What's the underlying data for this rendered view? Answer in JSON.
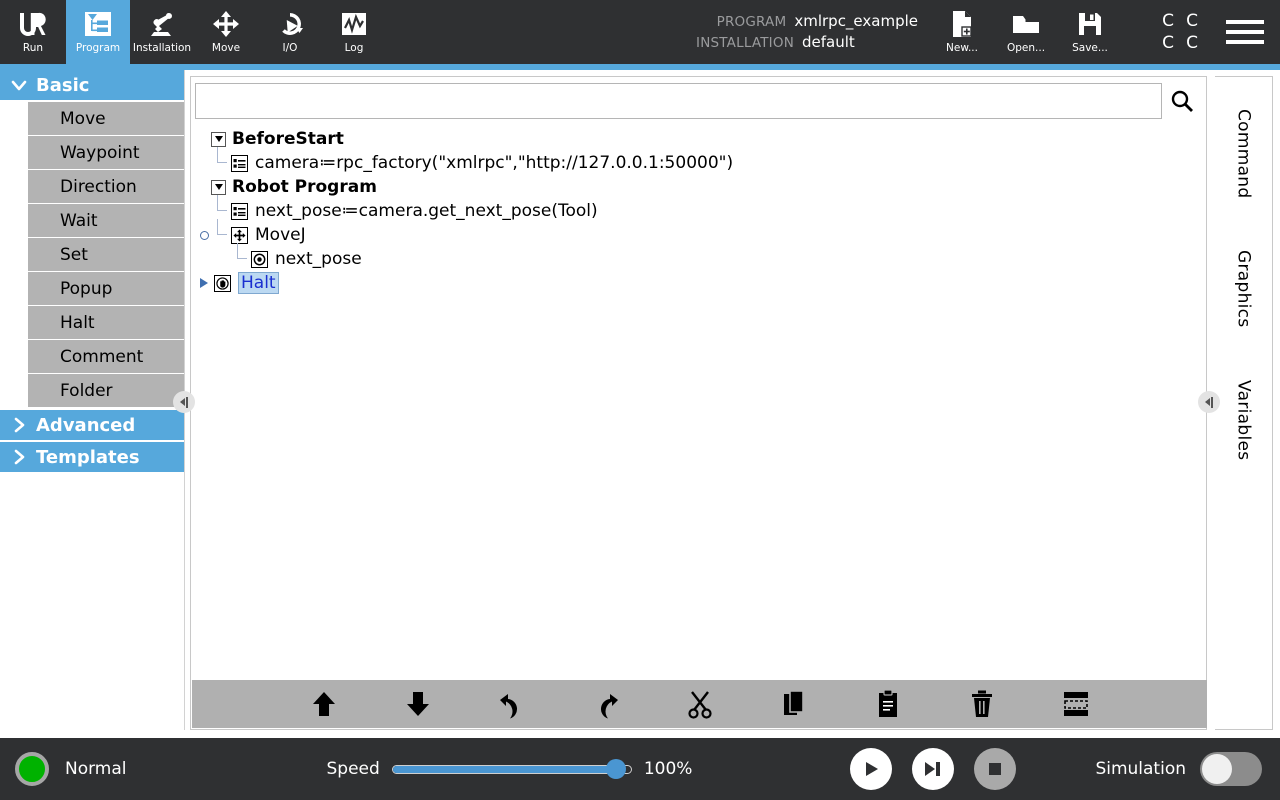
{
  "header": {
    "tabs": [
      {
        "label": "Run",
        "icon": "ur-logo-icon",
        "active": false
      },
      {
        "label": "Program",
        "icon": "program-tree-icon",
        "active": true
      },
      {
        "label": "Installation",
        "icon": "robot-arm-icon",
        "active": false
      },
      {
        "label": "Move",
        "icon": "move-arrows-icon",
        "active": false
      },
      {
        "label": "I/O",
        "icon": "io-gauge-icon",
        "active": false
      },
      {
        "label": "Log",
        "icon": "log-graph-icon",
        "active": false
      }
    ],
    "program_key": "PROGRAM",
    "program_value": "xmlrpc_example",
    "installation_key": "INSTALLATION",
    "installation_value": "default",
    "actions": [
      {
        "label": "New...",
        "icon": "new-file-icon"
      },
      {
        "label": "Open...",
        "icon": "open-folder-icon"
      },
      {
        "label": "Save...",
        "icon": "save-floppy-icon"
      }
    ],
    "cc_grid": [
      "C",
      "C",
      "C",
      "C"
    ],
    "menu_icon": "hamburger-menu-icon",
    "accent_color": "#56a8dc",
    "bar_color": "#2f3032"
  },
  "sidebar": {
    "groups": [
      {
        "label": "Basic",
        "expanded": true,
        "items": [
          "Move",
          "Waypoint",
          "Direction",
          "Wait",
          "Set",
          "Popup",
          "Halt",
          "Comment",
          "Folder"
        ]
      },
      {
        "label": "Advanced",
        "expanded": false,
        "items": []
      },
      {
        "label": "Templates",
        "expanded": false,
        "items": []
      }
    ],
    "collapse_handle_icon": "collapse-left-handle-icon"
  },
  "main": {
    "search": {
      "value": "",
      "placeholder": "",
      "button_icon": "search-icon"
    },
    "tree": [
      {
        "id": "before-start",
        "type": "node",
        "label": "BeforeStart",
        "depth": 0,
        "toggle_icon": "triangle-down-icon",
        "expanded": true
      },
      {
        "id": "camera-assign",
        "type": "leaf",
        "label": "camera≔rpc_factory(\"xmlrpc\",\"http://127.0.0.1:50000\")",
        "depth": 1,
        "icon": "script-assignment-icon",
        "selected": false
      },
      {
        "id": "robot-program",
        "type": "node",
        "label": "Robot Program",
        "depth": 0,
        "toggle_icon": "triangle-down-icon",
        "expanded": true
      },
      {
        "id": "next-pose-assign",
        "type": "leaf",
        "label": "next_pose≔camera.get_next_pose(Tool)",
        "depth": 1,
        "icon": "script-assignment-icon",
        "selected": false
      },
      {
        "id": "movej",
        "type": "leaf",
        "label": "MoveJ",
        "depth": 1,
        "icon": "move-arrows-icon",
        "gutter_icon": "pin-icon",
        "selected": false
      },
      {
        "id": "waypoint-next-pose",
        "type": "leaf",
        "label": "next_pose",
        "depth": 2,
        "icon": "waypoint-target-icon",
        "selected": false
      },
      {
        "id": "halt",
        "type": "leaf",
        "label": "Halt",
        "depth": 1,
        "icon": "halt-hand-icon",
        "gutter_icon": "current-line-arrow-icon",
        "selected": true
      }
    ],
    "toolbar": [
      {
        "name": "move-up-button",
        "icon": "arrow-up-icon"
      },
      {
        "name": "move-down-button",
        "icon": "arrow-down-icon"
      },
      {
        "name": "undo-button",
        "icon": "undo-arrow-icon"
      },
      {
        "name": "redo-button",
        "icon": "redo-arrow-icon"
      },
      {
        "name": "cut-button",
        "icon": "scissors-icon"
      },
      {
        "name": "copy-button",
        "icon": "copy-pages-icon"
      },
      {
        "name": "paste-button",
        "icon": "clipboard-paste-icon"
      },
      {
        "name": "delete-button",
        "icon": "trash-can-icon"
      },
      {
        "name": "suppress-button",
        "icon": "suppress-lines-icon"
      }
    ],
    "selection_bg": "#bcd9f2",
    "selection_fg": "#1a2fd0"
  },
  "right_tabs": [
    {
      "label": "Command",
      "active": true
    },
    {
      "label": "Graphics",
      "active": false
    },
    {
      "label": "Variables",
      "active": false
    }
  ],
  "right_handle_icon": "collapse-right-handle-icon",
  "footer": {
    "status_label": "Normal",
    "status_color": "#00b200",
    "speed_label": "Speed",
    "speed_value": "100%",
    "speed_percent": 100,
    "controls": [
      {
        "name": "play-button",
        "icon": "play-icon",
        "enabled": true
      },
      {
        "name": "step-button",
        "icon": "step-icon",
        "enabled": true
      },
      {
        "name": "stop-button",
        "icon": "stop-icon",
        "enabled": false
      }
    ],
    "simulation_label": "Simulation",
    "simulation_on": false
  }
}
